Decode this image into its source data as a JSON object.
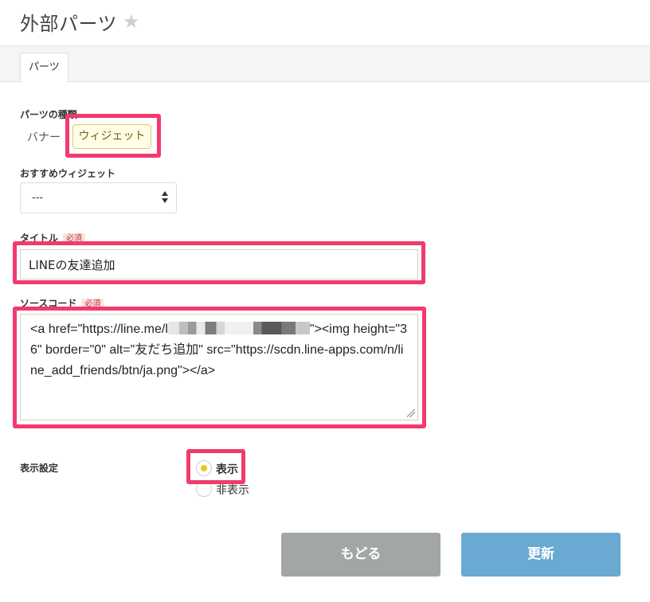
{
  "header": {
    "title": "外部パーツ",
    "favorite_icon": "star-icon"
  },
  "tabs": [
    {
      "label": "パーツ",
      "active": true
    }
  ],
  "form": {
    "parts_type": {
      "label": "パーツの種類",
      "options": [
        "バナー",
        "ウィジェット"
      ],
      "selected": "ウィジェット"
    },
    "recommended_widget": {
      "label": "おすすめウィジェット",
      "value": "---"
    },
    "title": {
      "label": "タイトル",
      "required_badge": "必須",
      "value": "LINEの友達追加"
    },
    "source_code": {
      "label": "ソースコード",
      "required_badge": "必須",
      "value_start": "<a href=\"https://line.me/l",
      "value_end": "\"><img height=\"36\" border=\"0\" alt=\"友だち追加\" src=\"https://scdn.line-apps.com/n/line_add_friends/btn/ja.png\"></a>"
    },
    "display_setting": {
      "label": "表示設定",
      "options": [
        {
          "label": "表示",
          "checked": true
        },
        {
          "label": "非表示",
          "checked": false
        }
      ]
    }
  },
  "buttons": {
    "back": "もどる",
    "update": "更新"
  },
  "colors": {
    "highlight": "#f23a6f",
    "radio_accent": "#f2c21a",
    "update_button": "#6aa9d2",
    "back_button": "#a3a6a7"
  }
}
